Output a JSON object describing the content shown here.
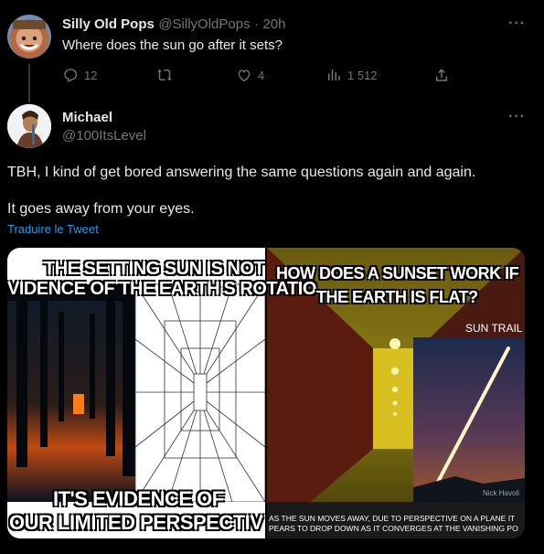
{
  "tweet1": {
    "display_name": "Silly Old Pops",
    "handle": "@SillyOldPops",
    "separator": "·",
    "time": "20h",
    "text": "Where does the sun go after it sets?",
    "replies": "12",
    "likes": "4",
    "views": "1 512"
  },
  "tweet2": {
    "display_name": "Michael",
    "handle": "@100ItsLevel",
    "line1": "TBH, I kind of get bored answering the same questions again and again.",
    "line2": "It goes away from your eyes.",
    "translate_link": "Traduire le Tweet"
  },
  "media": {
    "left_title_1": "THE SETTING SUN IS NOT",
    "left_title_2": "VIDENCE OF THE EARTH'S ROTATIO",
    "left_bottom_1": "IT'S EVIDENCE OF",
    "left_bottom_2": "OUR LIMITED PERSPECTIV",
    "right_title_1": "HOW DOES A SUNSET WORK IF",
    "right_title_2": "THE EARTH IS FLAT?",
    "sun_trail": "SUN TRAIL",
    "credit": "Nick Havoli",
    "caption_1": "AS THE SUN MOVES AWAY, DUE TO PERSPECTIVE ON A PLANE IT",
    "caption_2": "PEARS TO DROP DOWN AS IT CONVERGES AT THE VANISHING PO"
  },
  "icons": [
    "reply-icon",
    "retweet-icon",
    "like-icon",
    "views-icon",
    "share-icon",
    "more-icon"
  ]
}
